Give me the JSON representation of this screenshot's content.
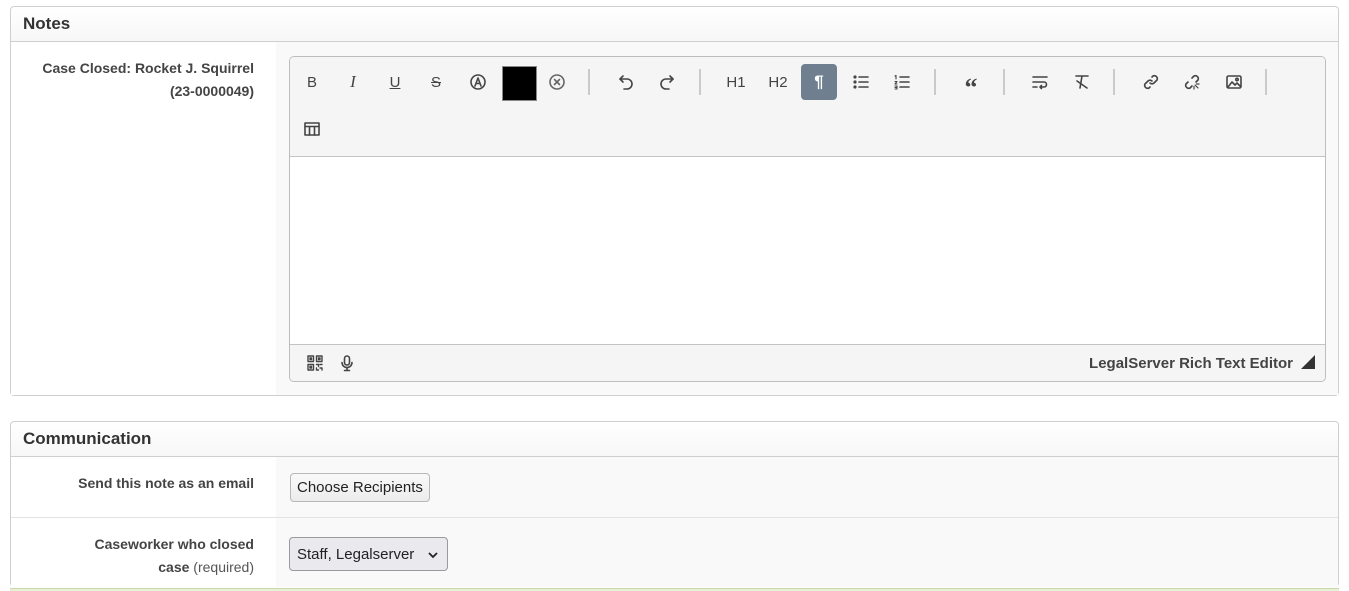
{
  "notes": {
    "title": "Notes",
    "label_line1": "Case Closed: Rocket J. Squirrel",
    "label_line2": "(23-0000049)",
    "editor": {
      "brand": "LegalServer Rich Text Editor",
      "text_color": "#000000",
      "toolbar": {
        "h1": "H1",
        "h2": "H2"
      }
    }
  },
  "communication": {
    "title": "Communication",
    "email_label": "Send this note as an email",
    "choose_recipients": "Choose Recipients",
    "caseworker_label_1": "Caseworker who closed",
    "caseworker_label_2": "case",
    "required": "(required)",
    "caseworker_value": "Staff, Legalserver"
  }
}
